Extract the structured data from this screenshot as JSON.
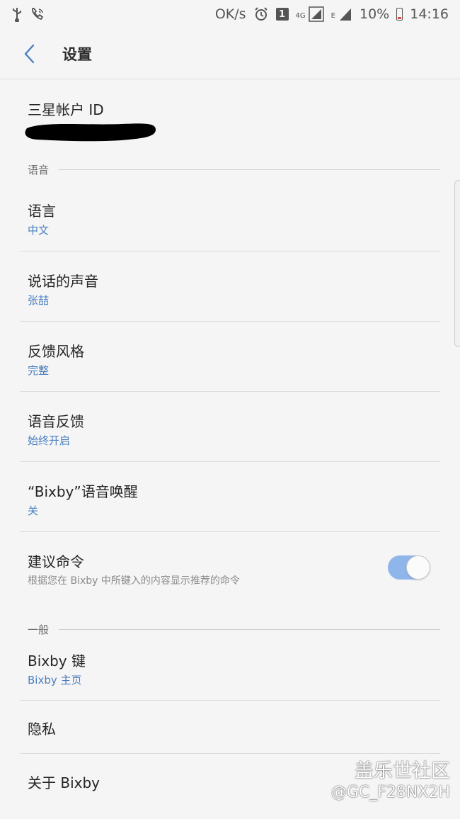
{
  "status_bar": {
    "speed": "OK/s",
    "sim_badge": "1",
    "net_4g": "4G",
    "net_e": "E",
    "battery": "10%",
    "time": "14:16"
  },
  "header": {
    "title": "设置",
    "back_icon": "chevron-left-icon"
  },
  "account": {
    "label": "三星帐户 ID"
  },
  "sections": {
    "voice": "语音",
    "general": "一般"
  },
  "items": {
    "language": {
      "title": "语言",
      "value": "中文"
    },
    "speaking_voice": {
      "title": "说话的声音",
      "value": "张喆"
    },
    "feedback_style": {
      "title": "反馈风格",
      "value": "完整"
    },
    "voice_feedback": {
      "title": "语音反馈",
      "value": "始终开启"
    },
    "voice_wakeup": {
      "title": "“Bixby”语音唤醒",
      "value": "关"
    },
    "suggested_commands": {
      "title": "建议命令",
      "desc": "根据您在 Bixby 中所键入的内容显示推荐的命令",
      "enabled": true
    },
    "bixby_key": {
      "title": "Bixby 键",
      "value": "Bixby 主页"
    },
    "privacy": {
      "title": "隐私"
    },
    "about": {
      "title": "关于 Bixby"
    }
  },
  "watermark": {
    "title": "盖乐世社区",
    "handle": "@GC_F28NX2H"
  },
  "colors": {
    "accent": "#4a7fc0",
    "toggle_on": "#8fb6ea",
    "background": "#f5f5f5"
  }
}
